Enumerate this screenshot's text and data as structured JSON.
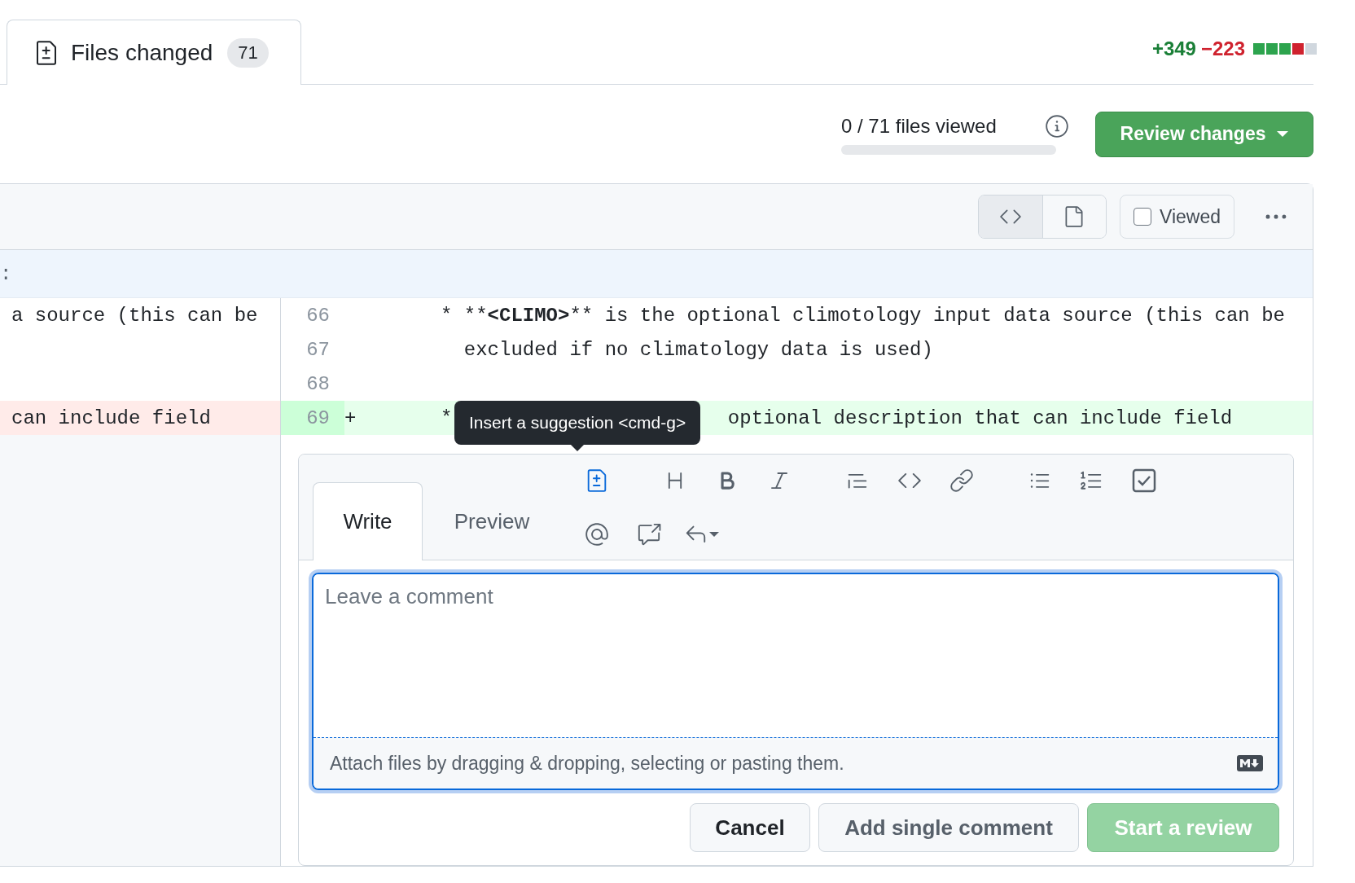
{
  "pr_tabs": [
    {
      "label": "Files changed",
      "count": "71",
      "selected": true
    }
  ],
  "diffstat": {
    "additions": "+349",
    "deletions": "−223",
    "blocks": [
      {
        "kind": "added"
      },
      {
        "kind": "added"
      },
      {
        "kind": "added"
      },
      {
        "kind": "deleted"
      },
      {
        "kind": "neutral"
      }
    ]
  },
  "files_viewed": {
    "label": "0 / 71 files viewed",
    "level": 0
  },
  "review_button": {
    "label": "Review changes"
  },
  "file_header": {
    "view_modes": [
      {
        "kind": "source",
        "selected": true
      },
      {
        "kind": "rich",
        "selected": false
      }
    ],
    "viewed": {
      "label": "Viewed",
      "checked": false
    }
  },
  "hunk_header": {
    "text": ":"
  },
  "diff_rows": [
    {
      "kind": "context",
      "left_text": "a source (this can be",
      "line": "66",
      "sign": "",
      "segments": [
        {
          "text": "* **",
          "bold": false
        },
        {
          "text": "<CLIMO>",
          "bold": true
        },
        {
          "text": "** is the optional climotology input data source (this can be",
          "bold": false
        }
      ]
    },
    {
      "kind": "context",
      "line": "67",
      "sign": "",
      "segments": [
        {
          "text": "  excluded if no climatology data is used)",
          "bold": false
        }
      ]
    },
    {
      "kind": "context",
      "line": "68",
      "sign": "",
      "segments": []
    },
    {
      "kind": "changed",
      "left_text": "can include field",
      "line": "69",
      "sign": "+",
      "segments": [
        {
          "text": "*",
          "bold": false
        },
        {
          "text": "optional description that can include field",
          "bold": false
        }
      ],
      "tooltip": {
        "text": "Insert a suggestion <cmd-g>"
      }
    }
  ],
  "comment_form": {
    "tabs": [
      {
        "label": "Write",
        "selected": true
      },
      {
        "label": "Preview",
        "selected": false
      }
    ],
    "toolbar": {
      "rows": [
        {
          "groups": [
            {
              "items": [
                {
                  "kind": "suggestion",
                  "highlighted": true
                }
              ]
            },
            {
              "items": [
                {
                  "kind": "heading",
                  "highlighted": false
                },
                {
                  "kind": "bold",
                  "highlighted": false
                },
                {
                  "kind": "italic",
                  "highlighted": false
                }
              ]
            },
            {
              "items": [
                {
                  "kind": "quote",
                  "highlighted": false
                },
                {
                  "kind": "code",
                  "highlighted": false
                },
                {
                  "kind": "link",
                  "highlighted": false
                }
              ]
            },
            {
              "items": [
                {
                  "kind": "unordered-list",
                  "highlighted": false
                },
                {
                  "kind": "ordered-list",
                  "highlighted": false
                },
                {
                  "kind": "task-list",
                  "highlighted": false
                }
              ]
            }
          ]
        },
        {
          "groups": [
            {
              "items": [
                {
                  "kind": "mention",
                  "highlighted": false
                },
                {
                  "kind": "cross-reference",
                  "highlighted": false
                },
                {
                  "kind": "saved-reply",
                  "highlighted": false
                }
              ]
            }
          ]
        }
      ]
    },
    "placeholder": "Leave a comment",
    "attach_hint": "Attach files by dragging & dropping, selecting or pasting them.",
    "buttons": [
      {
        "label": "Cancel",
        "kind": "default"
      },
      {
        "label": "Add single comment",
        "kind": "secondary"
      },
      {
        "label": "Start a review",
        "kind": "primary-disabled"
      }
    ]
  }
}
